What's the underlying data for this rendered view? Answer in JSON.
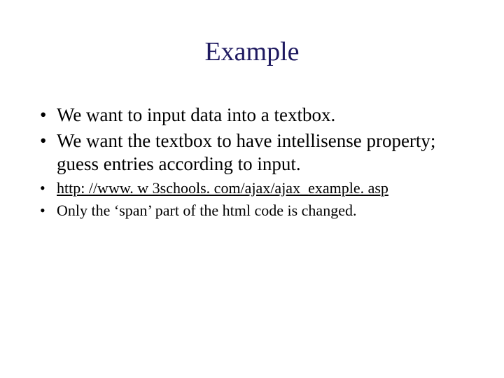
{
  "title": "Example",
  "bullets": {
    "b1": "We want to input data into a textbox.",
    "b2": "We want the textbox to have intellisense property; guess entries according to input.",
    "b3": "http: //www. w 3schools. com/ajax/ajax_example. asp",
    "b4": "Only the ‘span’ part of the html code is changed."
  }
}
